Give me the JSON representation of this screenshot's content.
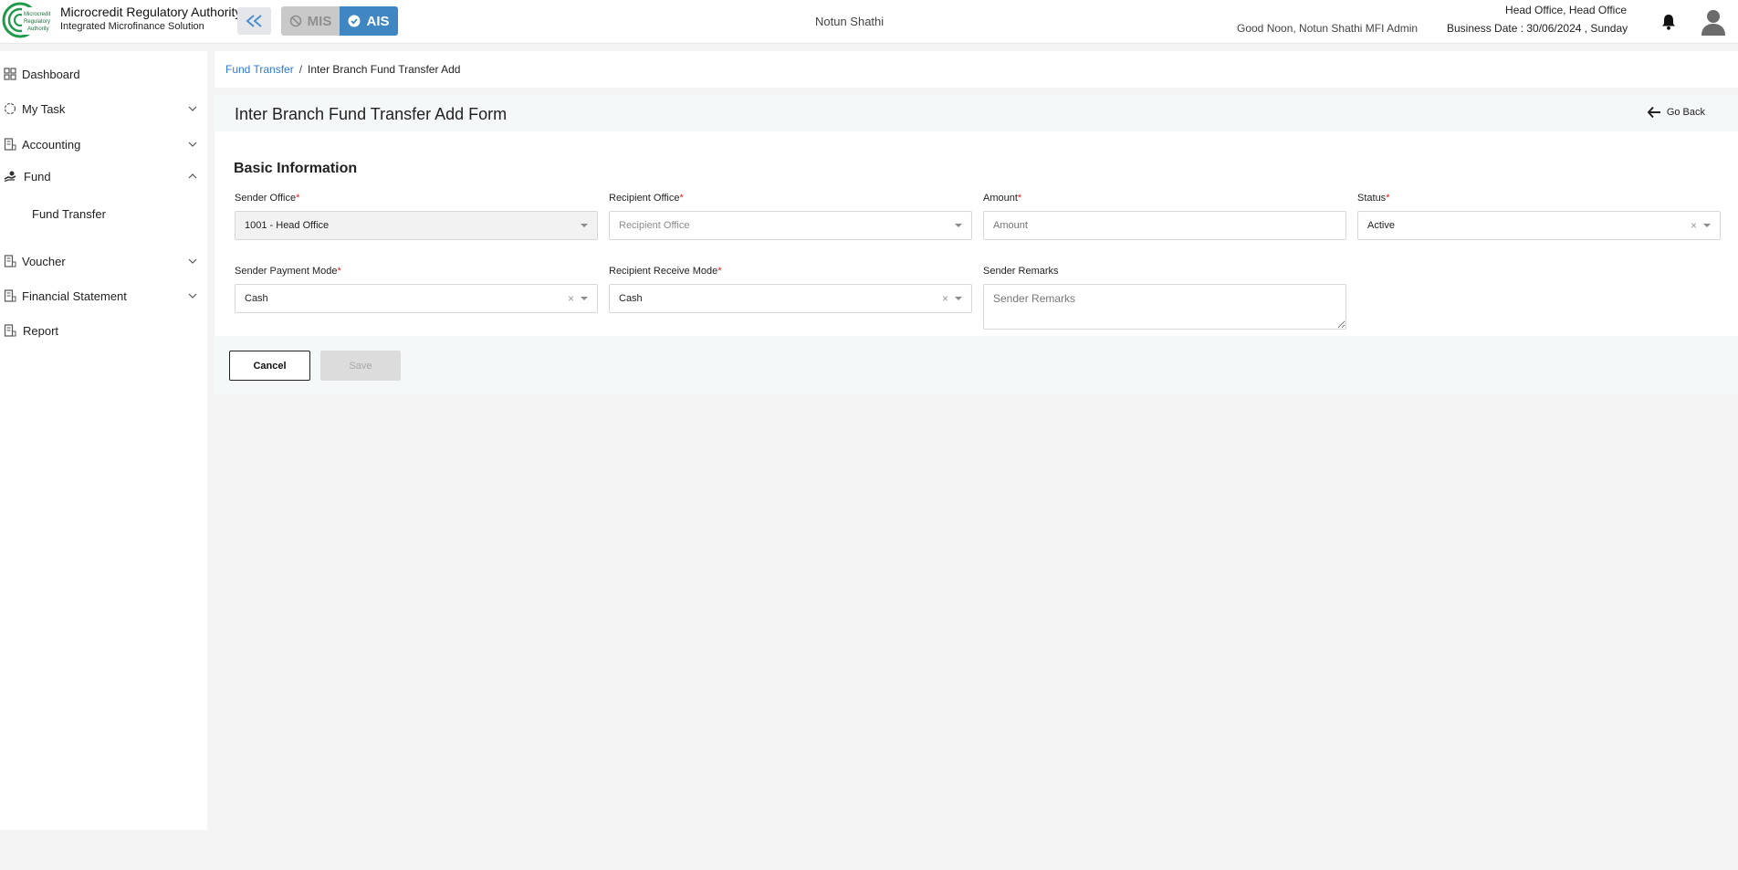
{
  "header": {
    "brand_title": "Microcredit Regulatory Authority",
    "brand_subtitle": "Integrated Microfinance Solution",
    "logo_text": "Microcredit Regulatory Authority",
    "switch_mis": "MIS",
    "switch_ais": "AIS",
    "center_name": "Notun Shathi",
    "greeting": "Good Noon, Notun Shathi MFI Admin",
    "office": "Head Office, Head Office",
    "business_date": "Business Date : 30/06/2024 , Sunday"
  },
  "sidebar": {
    "items": [
      {
        "label": "Dashboard",
        "icon": "grid-icon"
      },
      {
        "label": "My Task",
        "icon": "task-icon",
        "chevron": "down"
      },
      {
        "label": "Accounting",
        "icon": "ledger-icon",
        "chevron": "down"
      },
      {
        "label": "Fund",
        "icon": "hand-coin-icon",
        "chevron": "up"
      },
      {
        "label": "Voucher",
        "icon": "voucher-icon",
        "chevron": "down"
      },
      {
        "label": "Financial Statement",
        "icon": "statement-icon",
        "chevron": "down"
      },
      {
        "label": "Report",
        "icon": "report-icon"
      }
    ],
    "fund_sub": [
      "Fund Transfer"
    ]
  },
  "breadcrumb": {
    "link": "Fund Transfer",
    "separator": "/",
    "current": "Inter Branch Fund Transfer Add"
  },
  "form": {
    "title": "Inter Branch Fund Transfer Add Form",
    "go_back": "Go Back",
    "section": "Basic Information",
    "required_mark": "*",
    "fields": {
      "sender_office": {
        "label": "Sender Office",
        "value": "1001 - Head Office"
      },
      "recipient_office": {
        "label": "Recipient Office",
        "placeholder": "Recipient Office"
      },
      "amount": {
        "label": "Amount",
        "placeholder": "Amount"
      },
      "status": {
        "label": "Status",
        "value": "Active"
      },
      "sender_payment_mode": {
        "label": "Sender Payment Mode",
        "value": "Cash"
      },
      "recipient_receive_mode": {
        "label": "Recipient Receive Mode",
        "value": "Cash"
      },
      "sender_remarks": {
        "label": "Sender Remarks",
        "placeholder": "Sender Remarks"
      }
    },
    "clear_glyph": "×",
    "buttons": {
      "cancel": "Cancel",
      "save": "Save"
    }
  },
  "colors": {
    "accent": "#3f86c2",
    "link": "#2d7ad3",
    "required": "#e0201d",
    "logo_green": "#1f9a4b"
  }
}
